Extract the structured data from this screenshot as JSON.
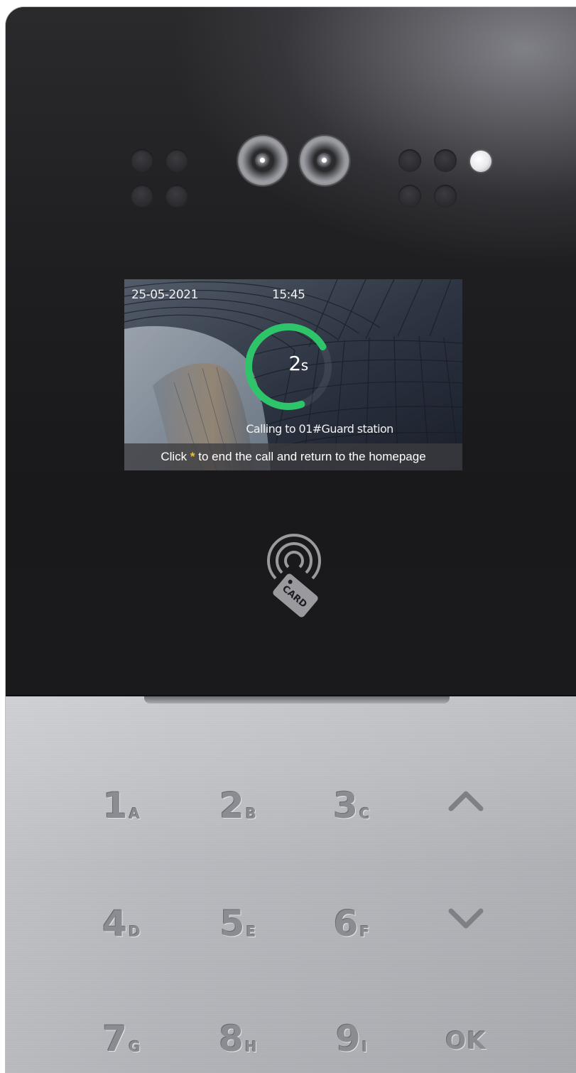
{
  "screen": {
    "date": "25-05-2021",
    "time": "15:45",
    "countdown_value": "2",
    "countdown_unit": "s",
    "countdown_progress": 0.72,
    "calling_text": "Calling to 01#Guard station",
    "hint_prefix": "Click",
    "hint_star": "*",
    "hint_suffix": "to end the call and return to the homepage",
    "accent_color": "#2ec46a",
    "star_color": "#f0c419"
  },
  "card_reader": {
    "label": "CARD",
    "icon": "nfc-card-icon"
  },
  "keypad": {
    "keys": [
      {
        "digit": "1",
        "letter": "A"
      },
      {
        "digit": "2",
        "letter": "B"
      },
      {
        "digit": "3",
        "letter": "C"
      },
      {
        "symbol": "up-arrow-icon"
      },
      {
        "digit": "4",
        "letter": "D"
      },
      {
        "digit": "5",
        "letter": "E"
      },
      {
        "digit": "6",
        "letter": "F"
      },
      {
        "symbol": "down-arrow-icon"
      },
      {
        "digit": "7",
        "letter": "G"
      },
      {
        "digit": "8",
        "letter": "H"
      },
      {
        "digit": "9",
        "letter": "I"
      },
      {
        "label": "OK"
      }
    ]
  }
}
